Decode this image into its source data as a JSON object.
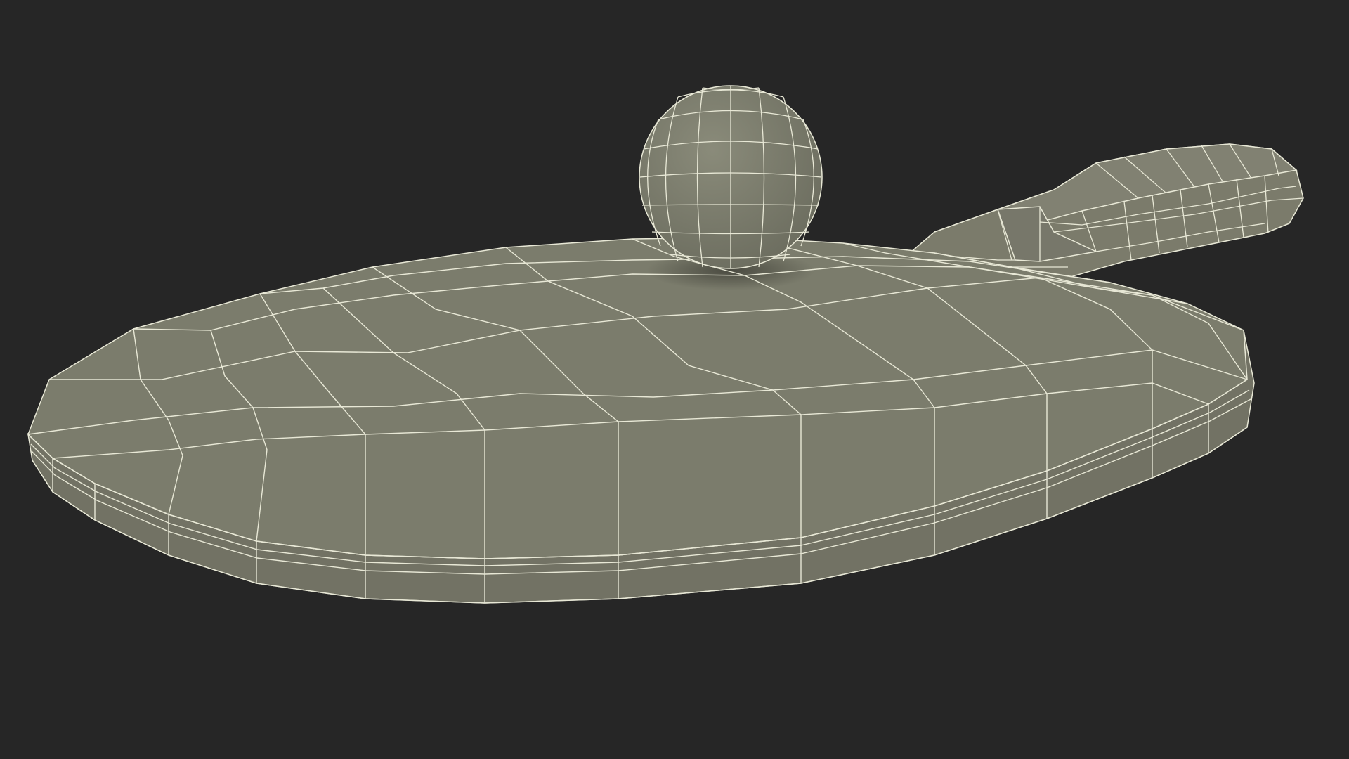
{
  "scene": {
    "subject": "wireframe-render",
    "objects": [
      "table-tennis-paddle",
      "table-tennis-ball"
    ]
  },
  "colors": {
    "background": "#262626",
    "surface_top": "#7c7c6c",
    "surface_side": "#6e6e60",
    "surface_dark": "#5a5a4e",
    "ball": "#7d7e6e",
    "wire": "#e8e8d6",
    "shadow": "#1f1f1c"
  }
}
